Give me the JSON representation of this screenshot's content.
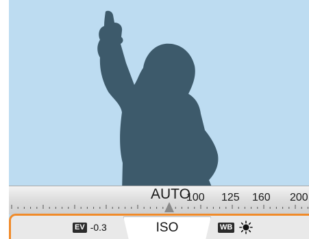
{
  "dial": {
    "current": "AUTO",
    "values": [
      "100",
      "125",
      "160",
      "200"
    ]
  },
  "bottom_bar": {
    "ev_badge": "EV",
    "ev_value": "-0.3",
    "mode_tab": "ISO",
    "wb_badge": "WB",
    "wb_icon": "sun-icon"
  },
  "colors": {
    "sky": "#bddcf1",
    "silhouette": "#3d5a6b",
    "accent": "#f08a28"
  }
}
